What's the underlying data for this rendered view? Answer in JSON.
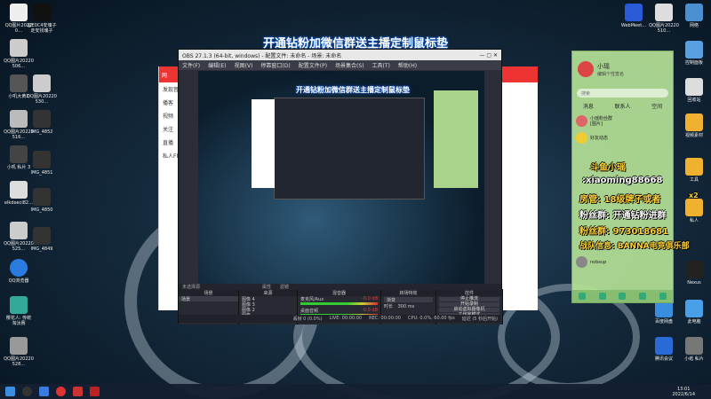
{
  "banners": {
    "main": "开通钻粉加微信群送主播定制鼠标垫",
    "preview": "开通钻粉加微信群送主播定制鼠标垫"
  },
  "obs": {
    "title": "OBS 27.1.3 (64-bit, windows) - 配置文件: 未命名 - 场景: 未命名",
    "menu": [
      "文件(F)",
      "编辑(E)",
      "视图(V)",
      "停靠窗口(D)",
      "配置文件(P)",
      "场景集合(S)",
      "工具(T)",
      "帮助(H)"
    ],
    "no_source": "未选择源",
    "properties_btn": "属性",
    "filters_btn": "滤镜",
    "docks": {
      "scenes": {
        "header": "场景",
        "items": [
          "场景"
        ]
      },
      "sources": {
        "header": "来源",
        "items": [
          "图像 4",
          "图像 3",
          "图像 2",
          "图像",
          "窗口捕获"
        ]
      },
      "mixer": {
        "header": "混音器",
        "tracks": [
          {
            "name": "麦克风/Aux",
            "level": "-0.0 dB"
          },
          {
            "name": "桌面音频",
            "level": "-0.0 dB"
          }
        ]
      },
      "transitions": {
        "header": "转场特效",
        "type": "渐变",
        "duration_label": "时长",
        "duration": "300 ms"
      },
      "controls": {
        "header": "控件",
        "buttons": [
          "停止推流",
          "开始录制",
          "启动虚拟摄像机",
          "工作室模式",
          "设置",
          "退出"
        ]
      }
    },
    "status": {
      "live": "LIVE: 00:00:00",
      "rec": "REC: 00:00:00",
      "cpu": "CPU: 0.0%, 60.00 fps",
      "dropped": "丢帧 0 (0.0%)",
      "delay": "延迟 (5 秒后开始)"
    }
  },
  "browser": {
    "header": "网",
    "items": [
      "发现音乐",
      "播客",
      "视频",
      "关注",
      "直播",
      "私人FM"
    ]
  },
  "qq": {
    "name": "小瑶",
    "signature": "编辑个性签名",
    "search": "搜索",
    "tabs": [
      "消息",
      "联系人",
      "空间"
    ],
    "contacts": [
      {
        "name": "小瑶粉丝群",
        "msg": "[图片]"
      },
      {
        "name": "好友动态",
        "msg": ""
      },
      {
        "name": "nobsup",
        "msg": ""
      }
    ]
  },
  "overlay_lines": [
    "斗鱼小瑶",
    ":xiaoming88668",
    "房管: 18级牌子或者",
    "粉丝群: 开通钻粉进群",
    "粉丝群: 973018681",
    "战队信息: BANNA电竞俱乐部"
  ],
  "overlay_suffix": "x2",
  "desktop_left": [
    {
      "label": "QQ图片20220…"
    },
    {
      "label": "QQ图片20220506…"
    },
    {
      "label": "小叽大黄2"
    },
    {
      "label": "QQ图片20220516…"
    },
    {
      "label": "小叽 私片 3"
    },
    {
      "label": "elkdeeci82…"
    },
    {
      "label": "QQ图片20220525…"
    },
    {
      "label": "QQ浏览器"
    },
    {
      "label": "樱花人: 传统 淘汰赛"
    },
    {
      "label": "QQ图片20220528…"
    }
  ],
  "desktop_left2": [
    {
      "label": "@E0C4安魂子 走安找魂子"
    },
    {
      "label": "QQ图片20220530…"
    },
    {
      "label": "IMG_4852"
    },
    {
      "label": "IMG_4851"
    },
    {
      "label": "IMG_4850"
    },
    {
      "label": "IMG_4849"
    }
  ],
  "desktop_right": [
    {
      "label": "WebMeet…"
    },
    {
      "label": "QQ图片20220510…"
    },
    {
      "label": "网络"
    },
    {
      "label": "控制面板"
    },
    {
      "label": "回收站"
    },
    {
      "label": "视频素材"
    },
    {
      "label": "工具"
    },
    {
      "label": "私人"
    },
    {
      "label": "Nexus"
    },
    {
      "label": "百度网盘"
    },
    {
      "label": "此电脑"
    },
    {
      "label": "腾讯会议"
    },
    {
      "label": "小纸 私片"
    }
  ],
  "clock": {
    "time": "13:01",
    "date": "2022/6/14"
  },
  "colors": {
    "obs_bg": "#2b2e38",
    "qq_bg": "#b4e196",
    "browser_red": "#e33333",
    "taskbar": "#142030"
  }
}
